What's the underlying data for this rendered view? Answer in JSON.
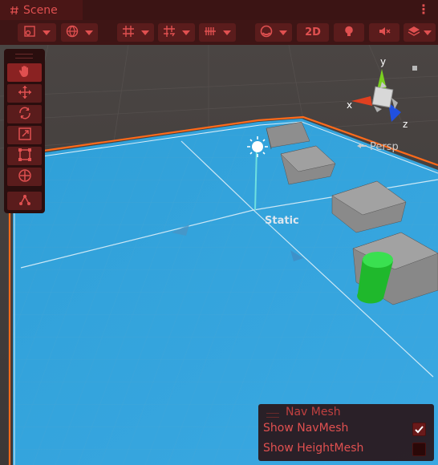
{
  "tab": {
    "icon": "hash-icon",
    "label": "Scene"
  },
  "window_menu": {
    "icon": "kebab-menu-icon",
    "label": "⋮"
  },
  "toolbar": {
    "buttons": [
      {
        "name": "draw-mode-button",
        "icon": "draw-mode-icon"
      },
      {
        "name": "global-local-button",
        "icon": "globe-icon"
      },
      {
        "name": "grid-snap-button",
        "icon": "grid-icon"
      },
      {
        "name": "increment-snap-button",
        "icon": "snap-icon"
      },
      {
        "name": "grid-visibility-button",
        "icon": "grid-lines-icon"
      },
      {
        "name": "shading-mode-button",
        "icon": "sphere-icon"
      },
      {
        "name": "2d-toggle-button",
        "label": "2D"
      },
      {
        "name": "lighting-toggle-button",
        "icon": "lightbulb-icon"
      },
      {
        "name": "audio-toggle-button",
        "icon": "audio-mute-icon"
      },
      {
        "name": "effects-button",
        "icon": "layers-icon"
      }
    ],
    "twod_label": "2D"
  },
  "tools": [
    {
      "name": "hand-tool",
      "icon": "hand-icon",
      "active": true
    },
    {
      "name": "move-tool",
      "icon": "move-icon"
    },
    {
      "name": "rotate-tool",
      "icon": "rotate-icon"
    },
    {
      "name": "scale-tool",
      "icon": "scale-icon"
    },
    {
      "name": "rect-tool",
      "icon": "rect-icon"
    },
    {
      "name": "transform-tool",
      "icon": "transform-icon"
    },
    {
      "name": "custom-tool",
      "icon": "custom-tool-icon"
    }
  ],
  "scene": {
    "static_label": "Static",
    "persp_label": "Persp",
    "gizmo": {
      "x": "x",
      "y": "y",
      "z": "z"
    },
    "colors": {
      "navmesh": "#33a8e0",
      "cylinder": "#20c030",
      "cube": "#8a8a8a",
      "selection": "#ff6a1a"
    }
  },
  "overlay": {
    "title": "Nav Mesh",
    "rows": [
      {
        "label": "Show NavMesh",
        "checked": true
      },
      {
        "label": "Show HeightMesh",
        "checked": false
      }
    ]
  }
}
